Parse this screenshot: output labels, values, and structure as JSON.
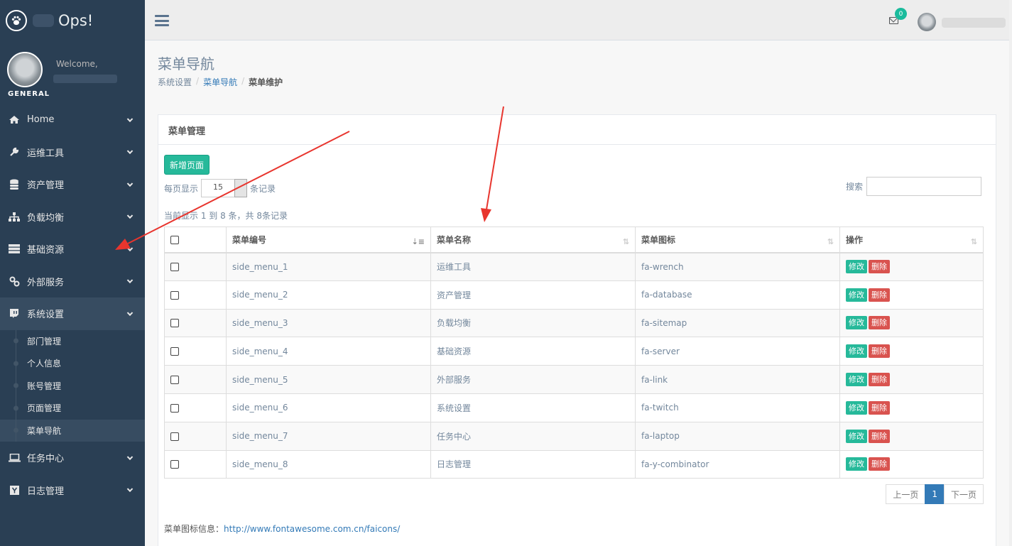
{
  "brand": {
    "title": "Ops!"
  },
  "profile": {
    "welcome": "Welcome,",
    "section": "GENERAL"
  },
  "sidebar": {
    "items": [
      {
        "label": "Home",
        "icon": "home-icon"
      },
      {
        "label": "运维工具",
        "icon": "wrench-icon"
      },
      {
        "label": "资产管理",
        "icon": "database-icon"
      },
      {
        "label": "负载均衡",
        "icon": "sitemap-icon"
      },
      {
        "label": "基础资源",
        "icon": "server-icon"
      },
      {
        "label": "外部服务",
        "icon": "link-icon"
      },
      {
        "label": "系统设置",
        "icon": "twitch-icon"
      },
      {
        "label": "任务中心",
        "icon": "laptop-icon"
      },
      {
        "label": "日志管理",
        "icon": "y-combinator-icon"
      }
    ],
    "sub_items": [
      "部门管理",
      "个人信息",
      "账号管理",
      "页面管理",
      "菜单导航"
    ]
  },
  "topnav": {
    "mail_count": "0"
  },
  "page": {
    "title": "菜单导航",
    "breadcrumb": [
      "系统设置",
      "菜单导航",
      "菜单维护"
    ]
  },
  "panel": {
    "title": "菜单管理",
    "new_button": "新增页面",
    "page_size_prefix": "每页显示",
    "page_size": "15",
    "page_size_suffix": "条记录",
    "search_label": "搜索",
    "info": "当前显示 1 到 8 条，共 8条记录",
    "columns": [
      "菜单编号",
      "菜单名称",
      "菜单图标",
      "操作"
    ],
    "rows": [
      {
        "id": "side_menu_1",
        "name": "运维工具",
        "icon": "fa-wrench"
      },
      {
        "id": "side_menu_2",
        "name": "资产管理",
        "icon": "fa-database"
      },
      {
        "id": "side_menu_3",
        "name": "负载均衡",
        "icon": "fa-sitemap"
      },
      {
        "id": "side_menu_4",
        "name": "基础资源",
        "icon": "fa-server"
      },
      {
        "id": "side_menu_5",
        "name": "外部服务",
        "icon": "fa-link"
      },
      {
        "id": "side_menu_6",
        "name": "系统设置",
        "icon": "fa-twitch"
      },
      {
        "id": "side_menu_7",
        "name": "任务中心",
        "icon": "fa-laptop"
      },
      {
        "id": "side_menu_8",
        "name": "日志管理",
        "icon": "fa-y-combinator"
      }
    ],
    "edit_label": "修改",
    "delete_label": "删除",
    "pager": {
      "prev": "上一页",
      "current": "1",
      "next": "下一页"
    },
    "icons_info_label": "菜单图标信息：",
    "icons_info_link": "http://www.fontawesome.com.cn/faicons/"
  },
  "colors": {
    "sidebar": "#2A3F54",
    "accent": "#26B99A",
    "danger": "#D9534F",
    "link": "#337AB7",
    "annotation_arrow": "#E8352E"
  }
}
